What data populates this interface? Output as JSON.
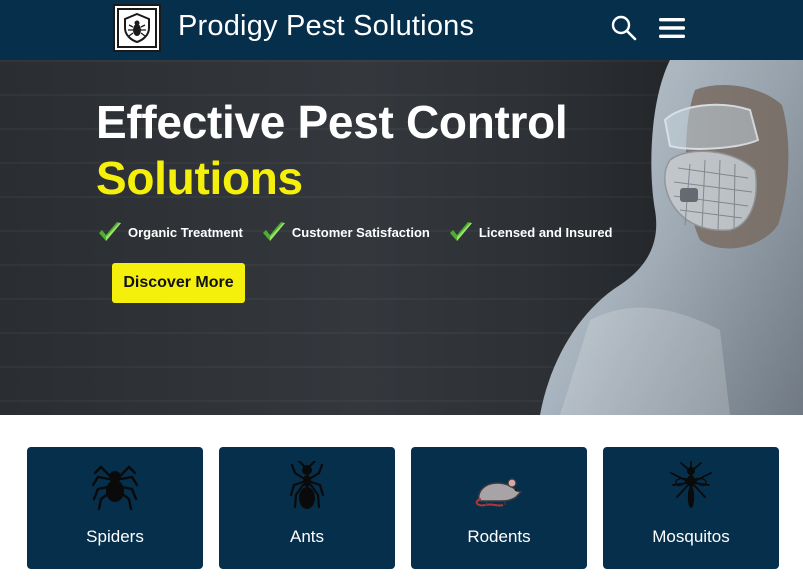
{
  "header": {
    "site_title": "Prodigy Pest Solutions",
    "logo_icon": "bug-shield-logo",
    "search_icon": "search-icon",
    "menu_icon": "hamburger-menu-icon",
    "background": "#062f4c"
  },
  "hero": {
    "title_line1": "Effective Pest Control",
    "title_line2": "Solutions",
    "features": [
      {
        "label": "Organic Treatment",
        "icon": "check-icon"
      },
      {
        "label": "Customer Satisfaction",
        "icon": "check-icon"
      },
      {
        "label": "Licensed and Insured",
        "icon": "check-icon"
      }
    ],
    "cta_label": "Discover More",
    "accent_color": "#f5ef0c"
  },
  "services": [
    {
      "label": "Spiders",
      "icon": "spider-icon"
    },
    {
      "label": "Ants",
      "icon": "ant-icon"
    },
    {
      "label": "Rodents",
      "icon": "rat-icon"
    },
    {
      "label": "Mosquitos",
      "icon": "mosquito-icon"
    }
  ]
}
